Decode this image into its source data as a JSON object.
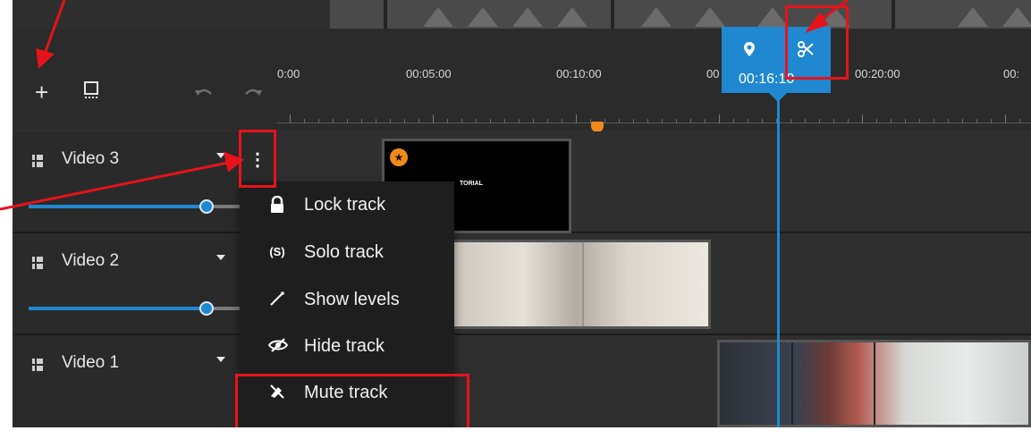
{
  "toolbar": {
    "add_icon": "plus-icon",
    "snap_icon": "snap-icon",
    "undo_icon": "undo-icon",
    "redo_icon": "redo-icon"
  },
  "ruler": {
    "ticks": [
      "0:00",
      "00:05:00",
      "00:10:00",
      "00",
      "00:20:00",
      "00:"
    ]
  },
  "playhead": {
    "time": "00:16:10",
    "marker_icon": "map-marker-icon",
    "split_icon": "scissors-icon"
  },
  "tracks": [
    {
      "name": "Video 3",
      "volume": 0.83
    },
    {
      "name": "Video 2",
      "volume": 0.83
    },
    {
      "name": "Video 1"
    }
  ],
  "clips": {
    "video3_title": "TORIAL"
  },
  "context_menu": {
    "items": [
      {
        "icon": "lock-icon",
        "label": "Lock track"
      },
      {
        "icon": "solo-icon",
        "glyph": "(S)",
        "label": "Solo track"
      },
      {
        "icon": "levels-icon",
        "label": "Show levels"
      },
      {
        "icon": "hide-icon",
        "label": "Hide track"
      },
      {
        "icon": "mute-icon",
        "label": "Mute track"
      }
    ]
  },
  "colors": {
    "accent": "#1f88d1",
    "marker": "#f28a1b",
    "annotation": "#e6131b"
  }
}
